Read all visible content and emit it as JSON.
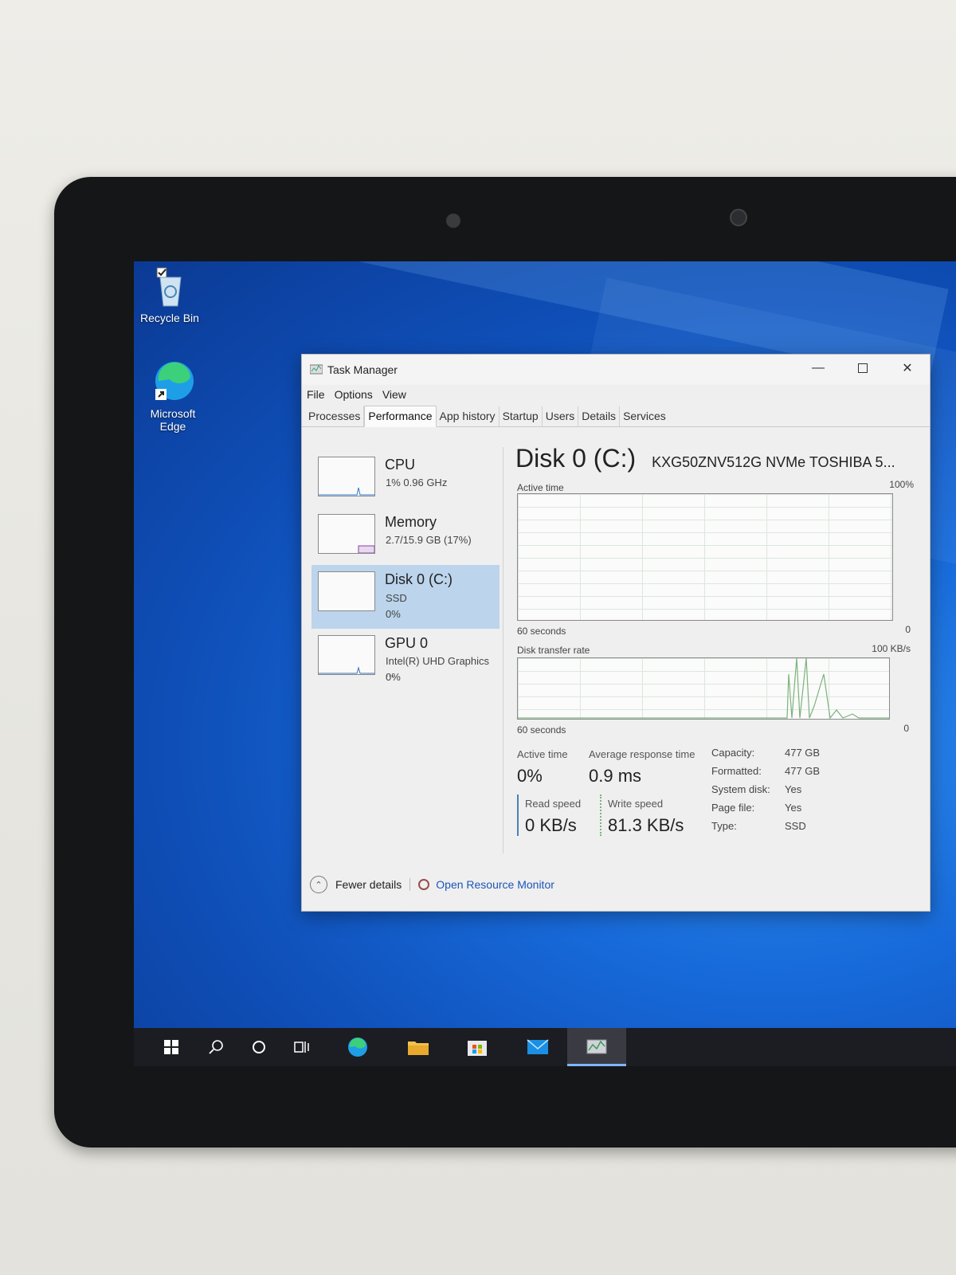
{
  "desktop": {
    "icons": [
      {
        "label": "Recycle Bin"
      },
      {
        "label": "Microsoft Edge"
      }
    ]
  },
  "window": {
    "title": "Task Manager",
    "menu": [
      "File",
      "Options",
      "View"
    ],
    "tabs": [
      "Processes",
      "Performance",
      "App history",
      "Startup",
      "Users",
      "Details",
      "Services"
    ],
    "selected_tab": "Performance",
    "resources": [
      {
        "name": "CPU",
        "line1": "1%  0.96 GHz",
        "line2": ""
      },
      {
        "name": "Memory",
        "line1": "2.7/15.9 GB (17%)",
        "line2": ""
      },
      {
        "name": "Disk 0 (C:)",
        "line1": "SSD",
        "line2": "0%"
      },
      {
        "name": "GPU 0",
        "line1": "Intel(R) UHD Graphics ...",
        "line2": "0%"
      }
    ],
    "detail": {
      "title": "Disk 0 (C:)",
      "model": "KXG50ZNV512G NVMe TOSHIBA 5...",
      "graph1": {
        "label": "Active time",
        "max": "100%",
        "time": "60 seconds",
        "min": "0"
      },
      "graph2": {
        "label": "Disk transfer rate",
        "max": "100 KB/s",
        "time": "60 seconds",
        "min": "0"
      },
      "stats": {
        "active_time_label": "Active time",
        "active_time": "0%",
        "avg_resp_label": "Average response time",
        "avg_resp": "0.9 ms",
        "read_label": "Read speed",
        "read": "0 KB/s",
        "write_label": "Write speed",
        "write": "81.3 KB/s"
      },
      "props": [
        {
          "k": "Capacity:",
          "v": "477 GB"
        },
        {
          "k": "Formatted:",
          "v": "477 GB"
        },
        {
          "k": "System disk:",
          "v": "Yes"
        },
        {
          "k": "Page file:",
          "v": "Yes"
        },
        {
          "k": "Type:",
          "v": "SSD"
        }
      ]
    },
    "footer": {
      "fewer": "Fewer details",
      "monitor": "Open Resource Monitor"
    }
  },
  "colors": {
    "accent": "#1a56b8",
    "selected": "#bcd4ec",
    "desktop": "#1769d9"
  }
}
